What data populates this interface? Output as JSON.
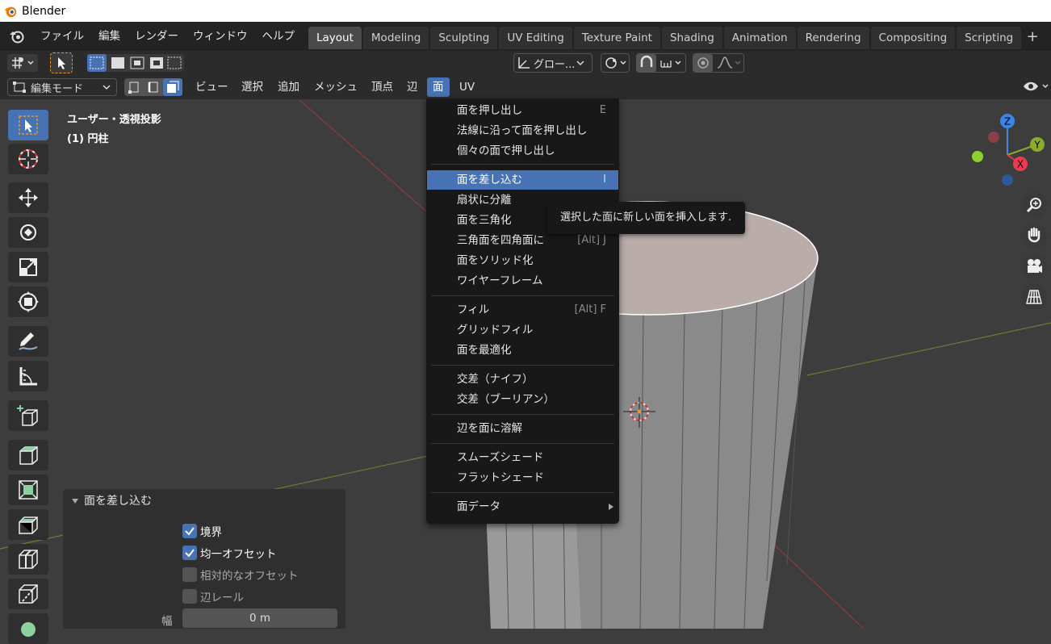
{
  "window": {
    "title": "Blender"
  },
  "top_menu": [
    "ファイル",
    "編集",
    "レンダー",
    "ウィンドウ",
    "ヘルプ"
  ],
  "workspaces": [
    {
      "label": "Layout",
      "active": true
    },
    {
      "label": "Modeling"
    },
    {
      "label": "Sculpting"
    },
    {
      "label": "UV Editing"
    },
    {
      "label": "Texture Paint"
    },
    {
      "label": "Shading"
    },
    {
      "label": "Animation"
    },
    {
      "label": "Rendering"
    },
    {
      "label": "Compositing"
    },
    {
      "label": "Scripting"
    }
  ],
  "workspace_add": "+",
  "tool_header": {
    "transform_orientation": "グロー..."
  },
  "mode_header": {
    "mode": "編集モード",
    "menus": [
      "ビュー",
      "選択",
      "追加",
      "メッシュ",
      "頂点",
      "辺",
      "面",
      "UV"
    ],
    "active_menu": "面"
  },
  "viewport": {
    "view_name": "ユーザー・透視投影",
    "object_name": "(1) 円柱",
    "gizmo": {
      "z": "Z",
      "y": "Y",
      "x": "X"
    }
  },
  "face_menu": {
    "groups": [
      [
        {
          "label": "面を押し出し",
          "shortcut": "E"
        },
        {
          "label": "法線に沿って面を押し出し"
        },
        {
          "label": "個々の面で押し出し"
        }
      ],
      [
        {
          "label": "面を差し込む",
          "shortcut": "I",
          "highlighted": true
        },
        {
          "label": "扇状に分離"
        },
        {
          "label": "面を三角化"
        },
        {
          "label": "三角面を四角面に",
          "shortcut": "[Alt] J"
        },
        {
          "label": "面をソリッド化"
        },
        {
          "label": "ワイヤーフレーム"
        }
      ],
      [
        {
          "label": "フィル",
          "shortcut": "[Alt] F"
        },
        {
          "label": "グリッドフィル"
        },
        {
          "label": "面を最適化"
        }
      ],
      [
        {
          "label": "交差（ナイフ）"
        },
        {
          "label": "交差（ブーリアン）"
        }
      ],
      [
        {
          "label": "辺を面に溶解"
        }
      ],
      [
        {
          "label": "スムーズシェード"
        },
        {
          "label": "フラットシェード"
        }
      ],
      [
        {
          "label": "面データ",
          "submenu": true
        }
      ]
    ]
  },
  "tooltip": {
    "text": "選択した面に新しい面を挿入します."
  },
  "operator_panel": {
    "title": "面を差し込む",
    "options": [
      {
        "label": "境界",
        "checked": true
      },
      {
        "label": "均一オフセット",
        "checked": true
      },
      {
        "label": "相対的なオフセット",
        "checked": false
      },
      {
        "label": "辺レール",
        "checked": false
      }
    ],
    "width_label": "幅",
    "width_value": "0 m"
  },
  "colors": {
    "accent": "#4772b3",
    "background": "#3d3d3d",
    "menu_bg": "#181818"
  }
}
